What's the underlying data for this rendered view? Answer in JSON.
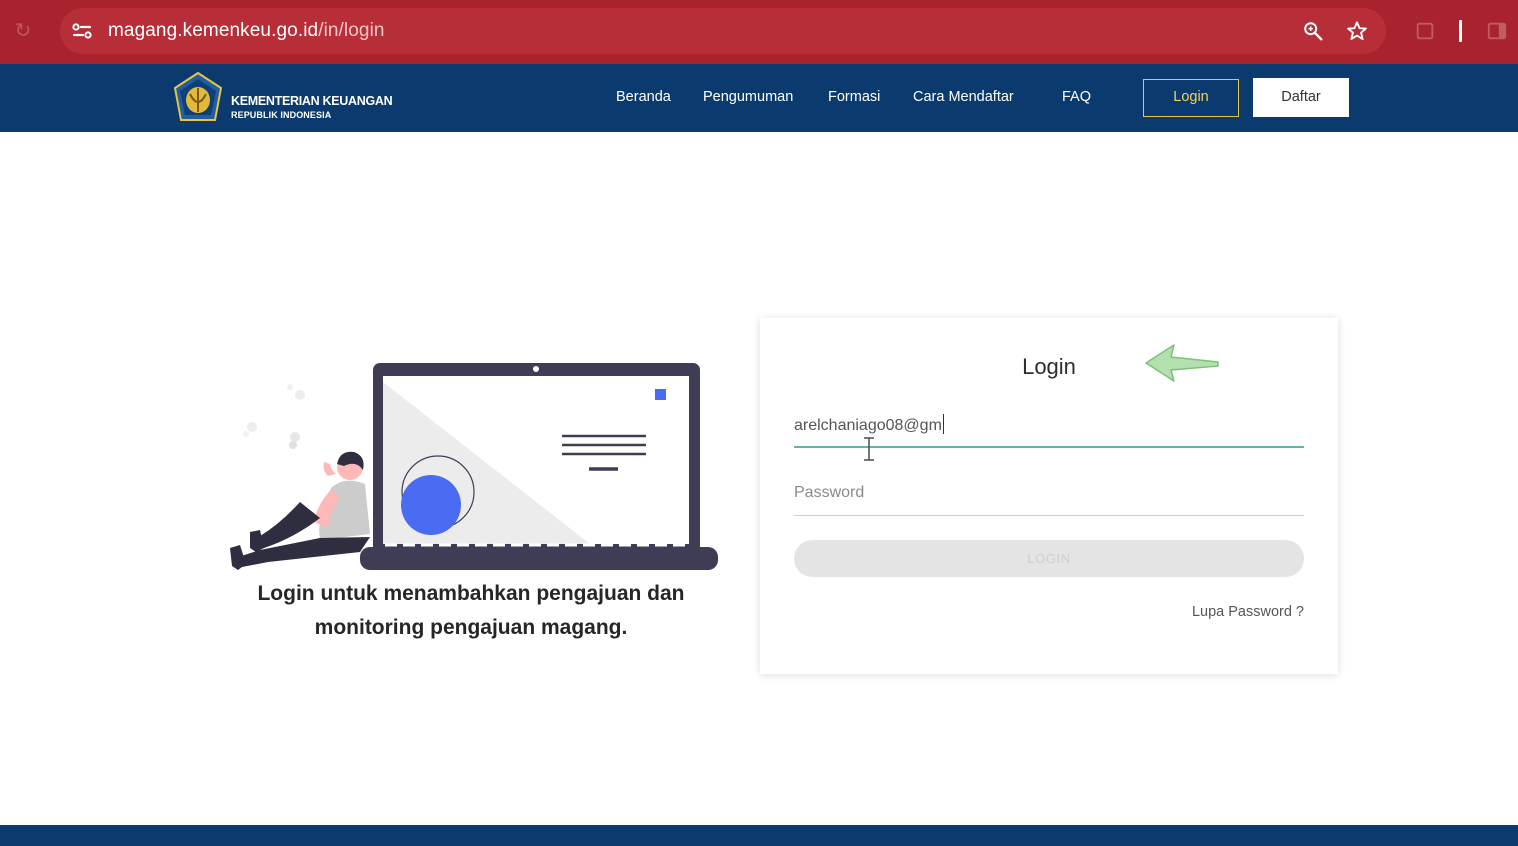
{
  "browser": {
    "url_host": "magang.kemenkeu.go.id",
    "url_path": "/in/login"
  },
  "header": {
    "logo_title": "KEMENTERIAN KEUANGAN",
    "logo_subtitle": "REPUBLIK INDONESIA",
    "nav": [
      "Beranda",
      "Pengumuman",
      "Formasi",
      "Cara Mendaftar",
      "FAQ"
    ],
    "login_label": "Login",
    "daftar_label": "Daftar"
  },
  "main": {
    "promo_line1": "Login untuk menambahkan pengajuan dan",
    "promo_line2": "monitoring pengajuan magang."
  },
  "login_card": {
    "title": "Login",
    "email_value": "arelchaniago08@gm",
    "password_placeholder": "Password",
    "submit_label": "LOGIN",
    "forgot_label": "Lupa Password ?"
  },
  "colors": {
    "browser_bar": "#a8232e",
    "header_bg": "#0b3b6e",
    "accent_yellow": "#e8c547",
    "field_focus": "#61b5a8",
    "illustration_blue": "#4a6cf2"
  }
}
